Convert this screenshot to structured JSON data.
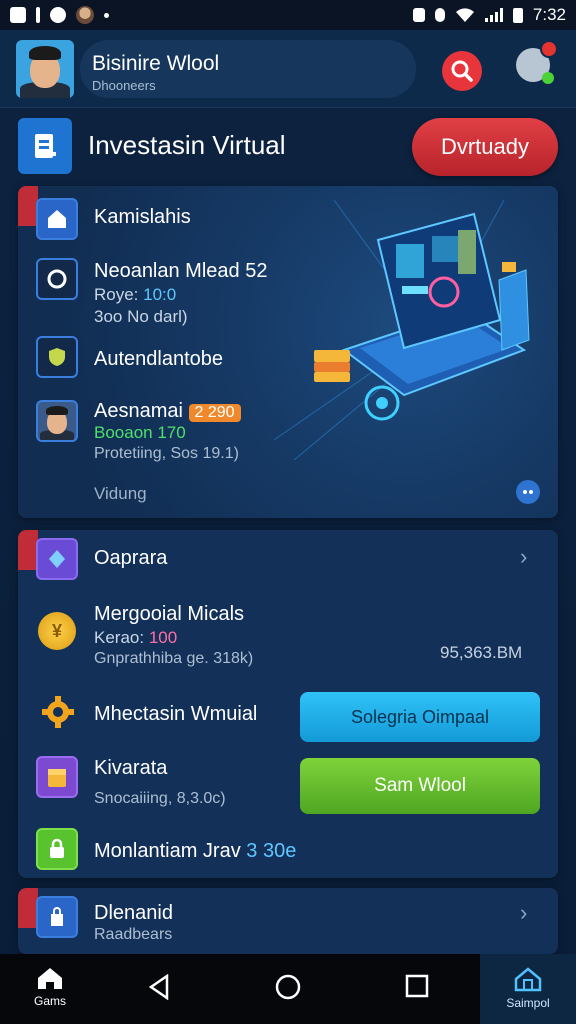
{
  "status_bar": {
    "time": "7:32"
  },
  "header": {
    "title": "Bisinire Wlool",
    "subtitle": "Dhooneers"
  },
  "section": {
    "title": "Investasin Virtual",
    "button_label": "Dvrtuady"
  },
  "card1": {
    "items": [
      {
        "label": "Kamislahis",
        "icon": "house-icon"
      },
      {
        "label": "Neoanlan Mlead 52",
        "line2_prefix": "Roye: ",
        "line2_value": "10:0",
        "line3": "3oo No darl)",
        "icon": "circle-icon"
      },
      {
        "label": "Autendlantobe",
        "icon": "shield-icon"
      },
      {
        "label": "Aesnamai",
        "badge": "2 290",
        "line2": "Booaon 170",
        "line3": "Protetiing, Sos 19.1)",
        "icon": "avatar"
      }
    ],
    "footer_label": "Vidung"
  },
  "card2": {
    "items": [
      {
        "label": "Oaprara",
        "icon": "gem-icon"
      },
      {
        "label": "Mergooial Micals",
        "line2_prefix": "Kerao: ",
        "line2_value": "100",
        "line3": "Gnprathhiba ge. 318k)",
        "icon": "coin-icon"
      },
      {
        "label": "Mhectasin Wmuial",
        "icon": "gear-icon"
      },
      {
        "label": "Kivarata",
        "line3": "Snocaiiing, 8,3.0c)",
        "icon": "box-icon"
      },
      {
        "label": "Monlantiam Jrav",
        "highlight": "3 30e",
        "icon": "lock-icon"
      }
    ],
    "amount": "95,363.BM",
    "btn_blue": "Solegria Oimpaal",
    "btn_green": "Sam Wlool"
  },
  "card3": {
    "title": "Dlenanid",
    "subtitle": "Raadbears"
  },
  "navbar": {
    "left_label": "Gams",
    "right_label": "Saimpol"
  },
  "colors": {
    "background": "#0c2340",
    "accent_red": "#e04045",
    "accent_blue": "#2fc2f7",
    "accent_green": "#7ed33a"
  }
}
